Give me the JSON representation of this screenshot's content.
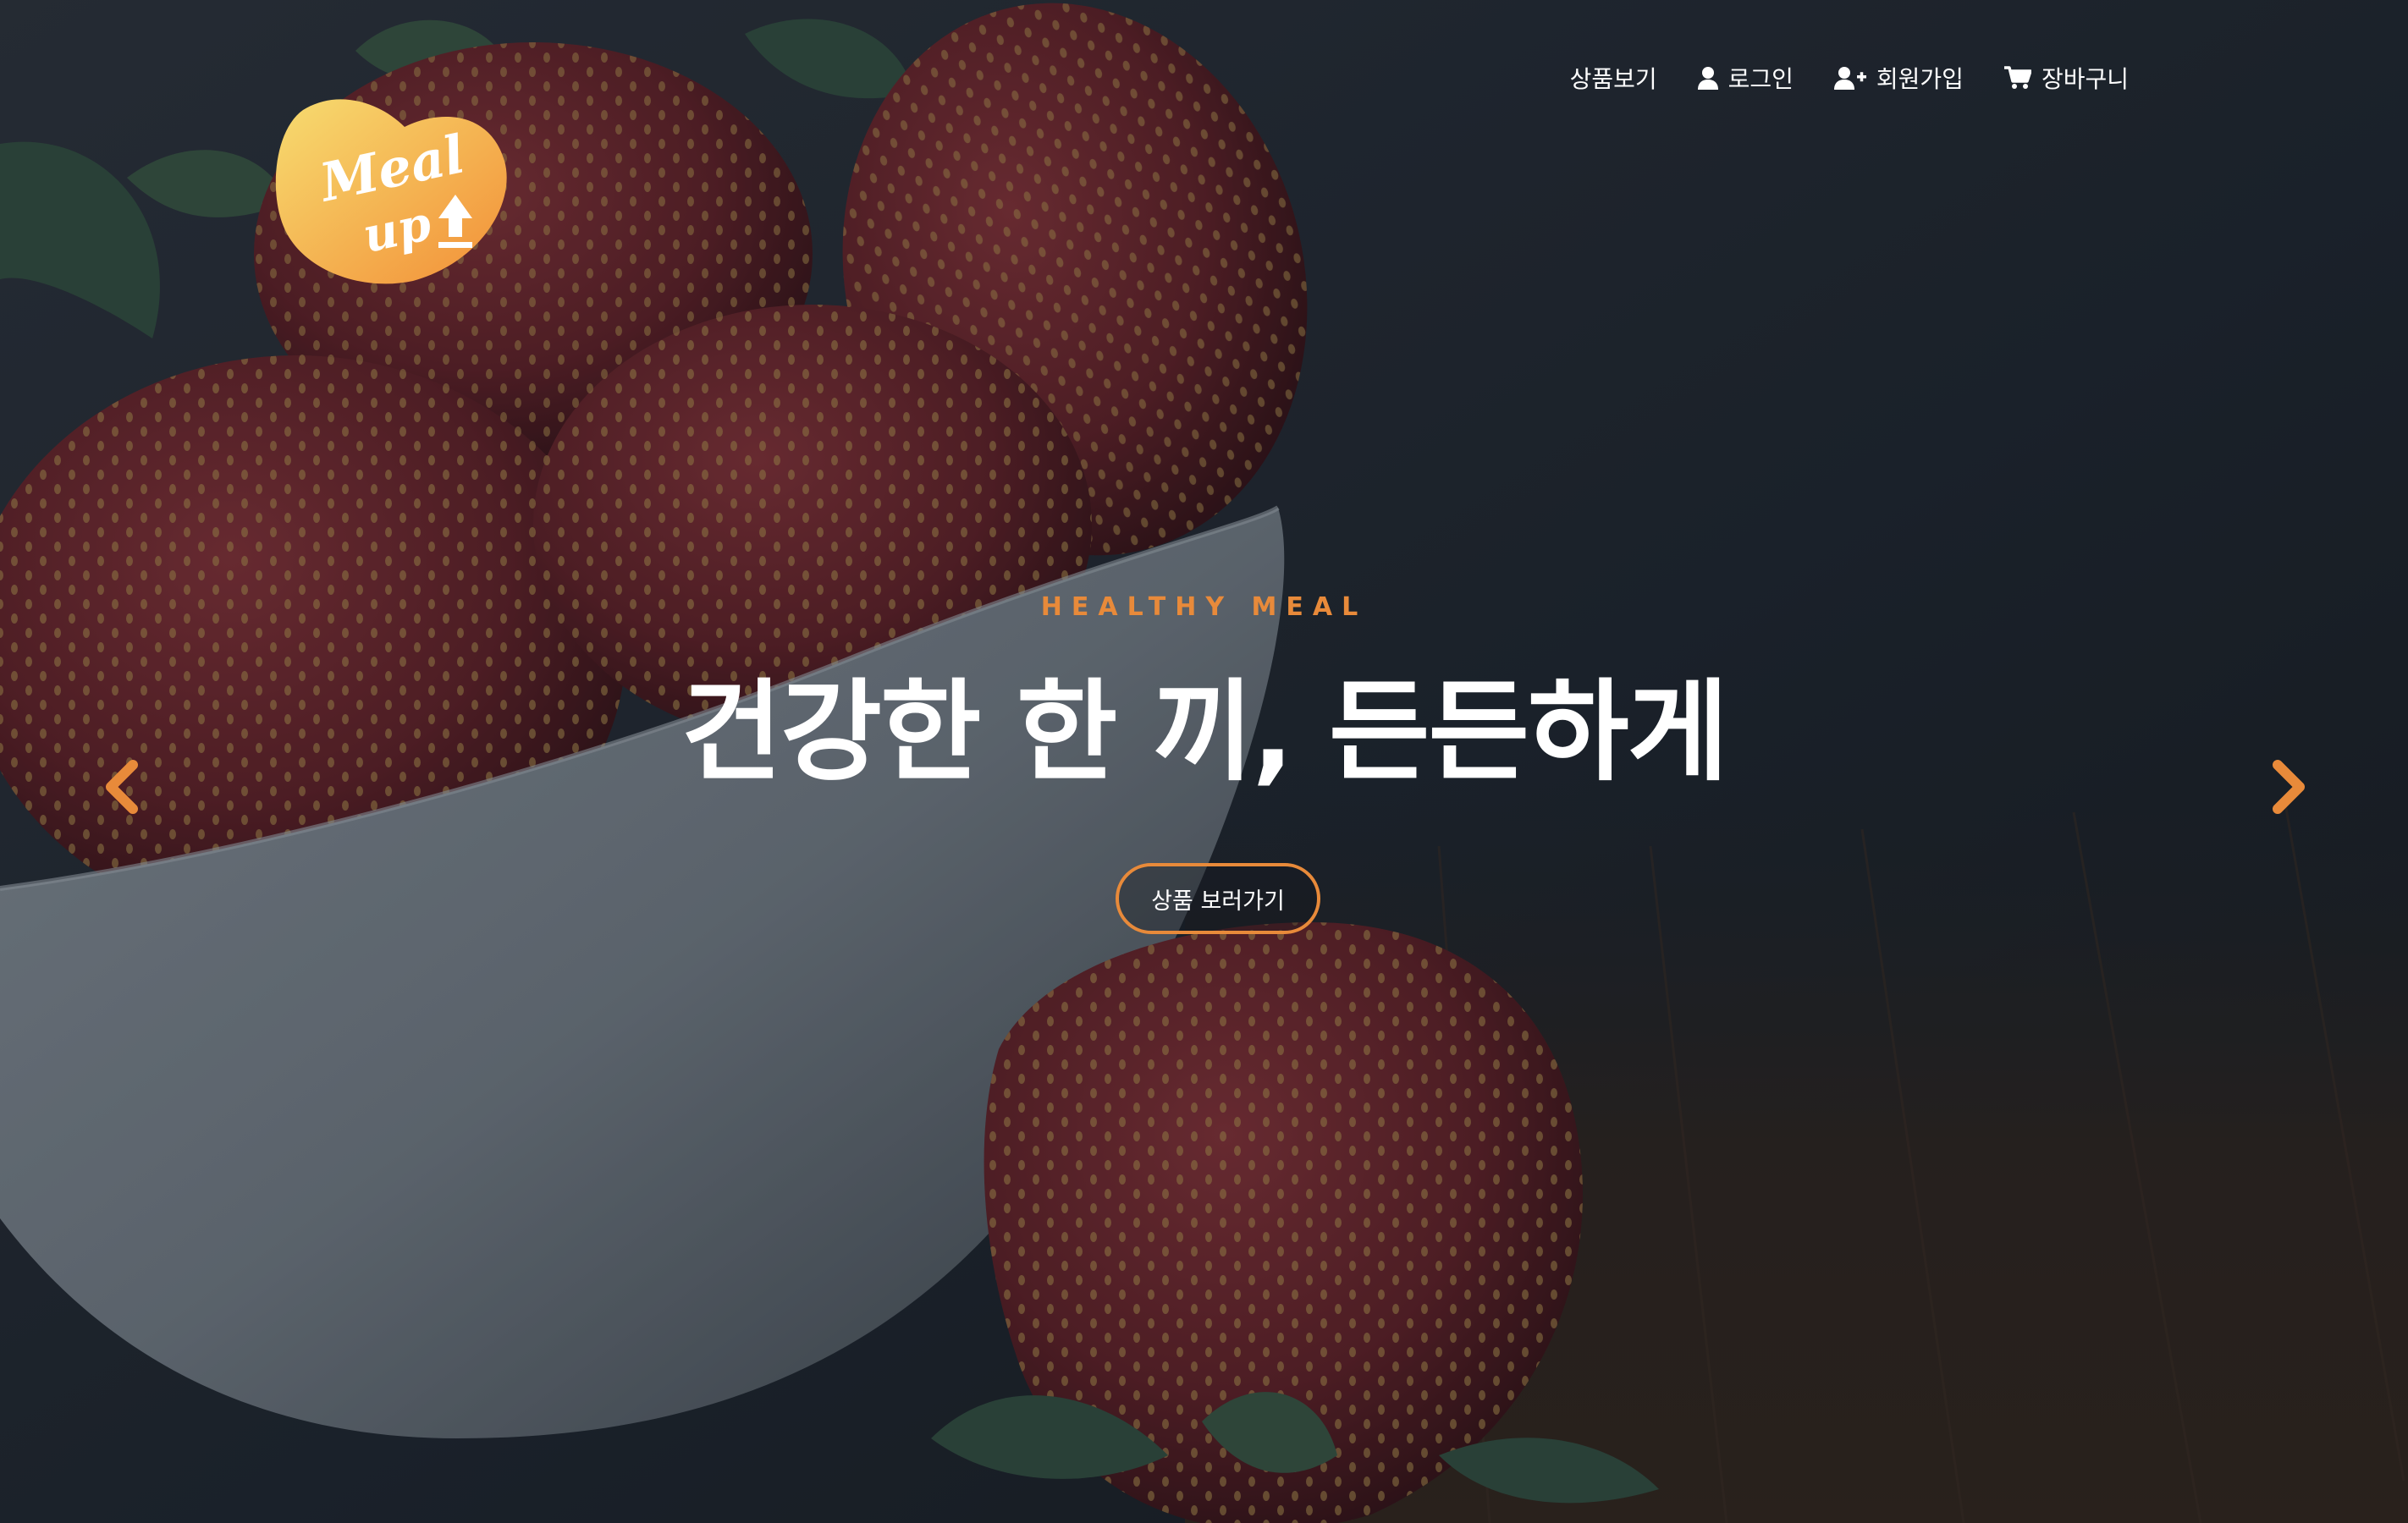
{
  "brand": {
    "logo_text_line1": "Meal",
    "logo_text_line2": "up",
    "logo_colors": [
      "#f7d56a",
      "#f39a3c"
    ]
  },
  "nav": {
    "items": [
      {
        "label": "상품보기",
        "icon": "none"
      },
      {
        "label": "로그인",
        "icon": "user-icon"
      },
      {
        "label": "회원가입",
        "icon": "user-plus-icon"
      },
      {
        "label": "장바구니",
        "icon": "cart-icon"
      }
    ]
  },
  "hero": {
    "eyebrow": "HEALTHY MEAL",
    "headline": "건강한 한 끼, 든든하게",
    "cta_label": "상품 보러가기",
    "accent_color": "#e88a3a",
    "prev_icon": "chevron-left-icon",
    "next_icon": "chevron-right-icon"
  }
}
